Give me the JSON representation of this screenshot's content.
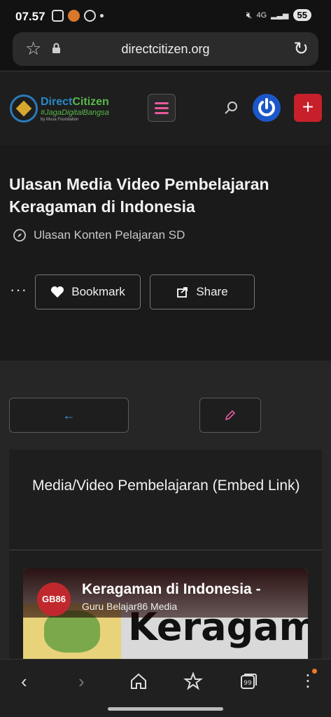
{
  "status_bar": {
    "time": "07.57",
    "network": "4G",
    "battery": "55"
  },
  "browser": {
    "url": "directcitizen.org"
  },
  "site": {
    "logo_name_a": "Direct",
    "logo_name_b": "Citizen",
    "logo_tagline": "#JagaDigitalBangsa",
    "logo_by": "by Musa Foundation",
    "plus_label": "+"
  },
  "article": {
    "title": "Ulasan Media Video Pembelajaran Keragaman di Indonesia",
    "category": "Ulasan Konten Pelajaran SD",
    "ellipsis": "···",
    "bookmark_label": "Bookmark",
    "share_label": "Share"
  },
  "content": {
    "back_arrow": "←",
    "section_title": "Media/Video Pembelajaran (Embed Link)",
    "video": {
      "channel_badge": "GB86",
      "title": "Keragaman di Indonesia -",
      "channel": "Guru Belajar86 Media",
      "thumb_text": "Keragam"
    }
  },
  "accent_colors": {
    "pink": "#e85a9b",
    "blue": "#1c57c9",
    "red": "#c8202a",
    "link": "#3a9be5"
  }
}
